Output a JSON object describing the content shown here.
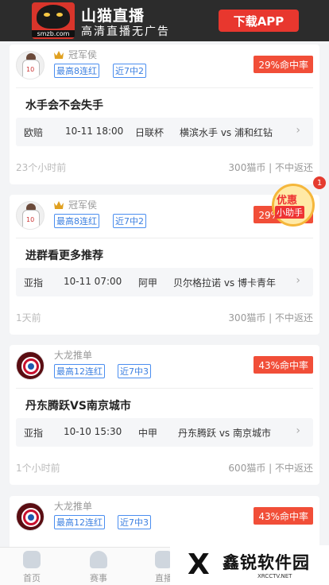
{
  "banner": {
    "logo_text": "smzb.com",
    "title": "山猫直播",
    "subtitle": "高清直播无广告",
    "download": "下载APP"
  },
  "cards": [
    {
      "author": "冠军侯",
      "crown": true,
      "badges": [
        "最高8连红",
        "近7中2"
      ],
      "hit_rate": "29%命中率",
      "title": "水手会不会失手",
      "match": {
        "type": "欧赔",
        "time": "10-11 18:00",
        "league": "日联杯",
        "teams": "横滨水手 vs 浦和红钻"
      },
      "posted": "23个小时前",
      "price": "300猫币 | 不中返还"
    },
    {
      "author": "冠军侯",
      "crown": true,
      "badges": [
        "最高8连红",
        "近7中2"
      ],
      "hit_rate": "29%命中率",
      "title": "进群看更多推荐",
      "match": {
        "type": "亚指",
        "time": "10-11 07:00",
        "league": "阿甲",
        "teams": "贝尔格拉诺 vs 博卡青年"
      },
      "posted": "1天前",
      "price": "300猫币 | 不中返还"
    },
    {
      "author": "大龙推单",
      "crown": false,
      "badges": [
        "最高12连红",
        "近7中3"
      ],
      "hit_rate": "43%命中率",
      "title": "丹东腾跃VS南京城市",
      "match": {
        "type": "亚指",
        "time": "10-10 15:30",
        "league": "中甲",
        "teams": "丹东腾跃 vs 南京城市"
      },
      "posted": "1个小时前",
      "price": "600猫币 | 不中返还"
    },
    {
      "author": "大龙推单",
      "crown": false,
      "badges": [
        "最高12连红",
        "近7中3"
      ],
      "hit_rate": "43%命中率"
    }
  ],
  "promo": {
    "line1": "优惠",
    "line2": "小助手",
    "count": "1"
  },
  "tabs": [
    {
      "label": "首页",
      "icon": "home-icon"
    },
    {
      "label": "赛事",
      "icon": "trophy-icon"
    },
    {
      "label": "直播",
      "icon": "tv-icon"
    }
  ],
  "watermark": {
    "mark": "X",
    "text": "鑫锐软件园",
    "url": "XRCCTV.NET"
  },
  "colors": {
    "accent": "#f14e38",
    "badge": "#4a8ef0",
    "banner": "#2c2c2c"
  }
}
